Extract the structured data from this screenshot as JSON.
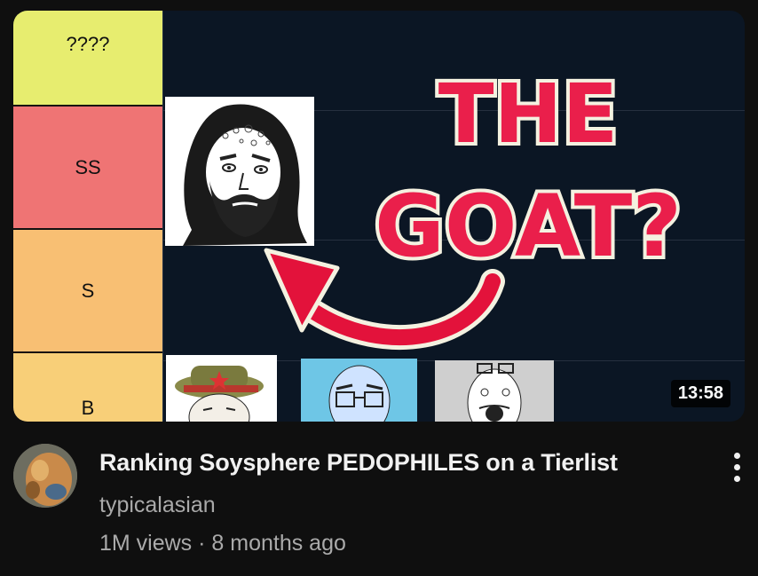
{
  "video": {
    "title": "Ranking Soysphere PEDOPHILES on a Tierlist",
    "channel": "typicalasian",
    "views": "1M views",
    "separator": " · ",
    "age": "8 months ago",
    "duration": "13:58"
  },
  "thumbnail": {
    "tiers": [
      "????",
      "SS",
      "S",
      "B"
    ],
    "headline_line1": "THE",
    "headline_line2": "GOAT?",
    "colors": {
      "tier_q": "#e7ed6f",
      "tier_ss": "#ef7474",
      "tier_s": "#f8bf73",
      "tier_b": "#f8cf78",
      "headline_red": "#ea1f4b",
      "arrow_red": "#e3123b",
      "background": "#0b1624"
    }
  },
  "icons": {
    "more": "more-vert-icon"
  }
}
